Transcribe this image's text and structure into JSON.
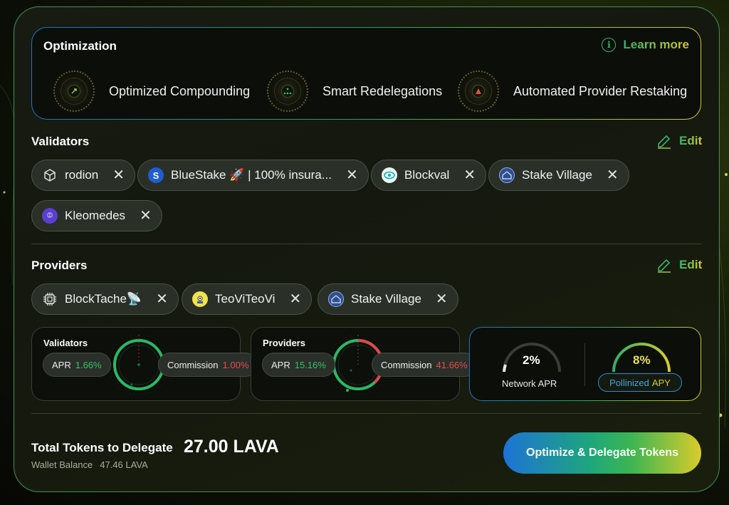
{
  "optimization": {
    "title": "Optimization",
    "learn_more": "Learn more",
    "features": [
      {
        "label": "Optimized Compounding",
        "icon": "compounding-icon"
      },
      {
        "label": "Smart Redelegations",
        "icon": "redelegation-icon"
      },
      {
        "label": "Automated Provider Restaking",
        "icon": "restaking-icon"
      }
    ]
  },
  "validators": {
    "title": "Validators",
    "edit": "Edit",
    "chips": [
      {
        "label": "rodion",
        "icon": "cube-icon"
      },
      {
        "label": "BlueStake 🚀 | 100% insura...",
        "icon": "bluestake-logo-icon"
      },
      {
        "label": "Blockval",
        "icon": "blockval-logo-icon"
      },
      {
        "label": "Stake Village",
        "icon": "stake-village-logo-icon"
      },
      {
        "label": "Kleomedes",
        "icon": "kleomedes-logo-icon"
      }
    ]
  },
  "providers": {
    "title": "Providers",
    "edit": "Edit",
    "chips": [
      {
        "label": "BlockTache📡",
        "icon": "chip-icon"
      },
      {
        "label": "TeoViTeoVi",
        "icon": "teovi-logo-icon"
      },
      {
        "label": "Stake Village",
        "icon": "stake-village-logo-icon"
      }
    ]
  },
  "stats": {
    "validators": {
      "title": "Validators",
      "apr_label": "APR",
      "apr_value": "1.66%",
      "commission_label": "Commission",
      "commission_value": "1.00%"
    },
    "providers": {
      "title": "Providers",
      "apr_label": "APR",
      "apr_value": "15.16%",
      "commission_label": "Commission",
      "commission_value": "41.66%"
    },
    "network_apr": {
      "value": "2%",
      "label": "Network APR"
    },
    "pollinized_apy": {
      "value": "8%",
      "label_part1": "Pollinized",
      "label_part2": "APY"
    }
  },
  "footer": {
    "total_label": "Total Tokens to Delegate",
    "total_value": "27.00 LAVA",
    "wallet_label": "Wallet Balance",
    "wallet_value": "47.46 LAVA",
    "cta": "Optimize & Delegate Tokens"
  },
  "colors": {
    "accent_green": "#34c06a",
    "accent_red": "#e84a4a",
    "accent_blue": "#1d73d6",
    "accent_yellow": "#d9cc2a"
  }
}
